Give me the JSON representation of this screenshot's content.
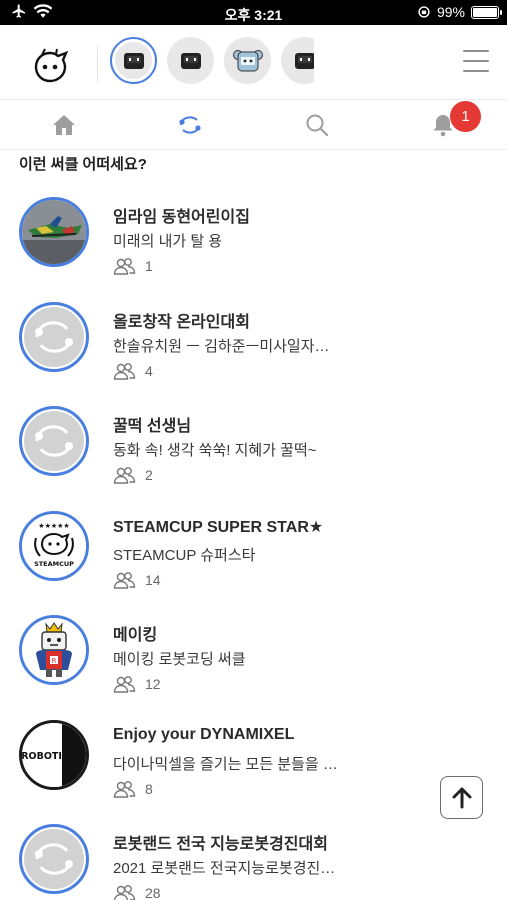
{
  "status_bar": {
    "time": "오후 3:21",
    "battery": "99%",
    "battery_level": 0.99
  },
  "header": {
    "circle_avatars": [
      {
        "name": "robot-screen-face-icon",
        "selected": true
      },
      {
        "name": "robot-screen-face-icon",
        "selected": false
      },
      {
        "name": "koala-robot-icon",
        "selected": false
      },
      {
        "name": "robot-screen-face-icon",
        "selected": false
      }
    ]
  },
  "tabs": [
    {
      "name": "home-icon"
    },
    {
      "name": "circle-link-icon",
      "active": true
    },
    {
      "name": "search-icon"
    },
    {
      "name": "bell-icon",
      "badge": "1"
    }
  ],
  "section_title": "이런 써클 어떠세요?",
  "circles": [
    {
      "title": "임라임 동현어린이집",
      "description": "미래의 내가 탈 용",
      "members": "1",
      "thumb": "photo"
    },
    {
      "title": "올로창작 온라인대회",
      "description": "한솔유치원 ㅡ 김하준ㅡ미사일자…",
      "members": "4",
      "thumb": "placeholder"
    },
    {
      "title": "꿀떡 선생님",
      "description": "동화 속! 생각 쑥쑥! 지혜가 꿀떡~",
      "members": "2",
      "thumb": "placeholder"
    },
    {
      "title": "STEAMCUP SUPER STAR★",
      "description": "STEAMCUP 슈퍼스타",
      "members": "14",
      "thumb": "steamcup",
      "thumb_text": "STEAMCUP"
    },
    {
      "title": "메이킹",
      "description": "메이킹 로봇코딩 써클",
      "members": "12",
      "thumb": "robot-king"
    },
    {
      "title": "Enjoy your DYNAMIXEL",
      "description": "다이나믹셀을 즐기는 모든 분들을 …",
      "members": "8",
      "thumb": "robotis",
      "thumb_text": "ROBOTIS"
    },
    {
      "title": "로봇랜드 전국 지능로봇경진대회",
      "description": "2021 로봇랜드 전국지능로봇경진…",
      "members": "28",
      "thumb": "placeholder"
    }
  ],
  "colors": {
    "accent": "#4a7fe0",
    "badge": "#e53935"
  }
}
